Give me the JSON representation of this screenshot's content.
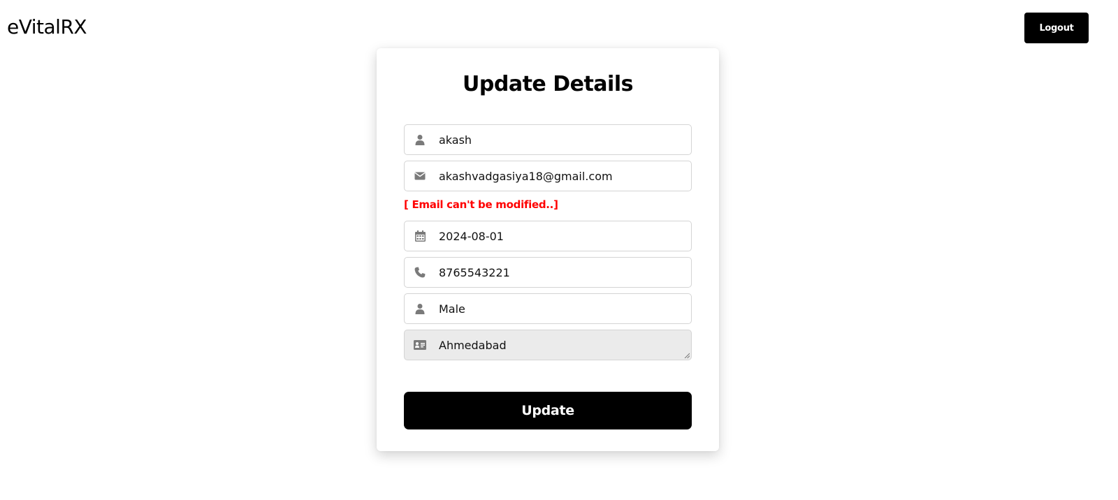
{
  "header": {
    "brand": "eVitalRX",
    "logout_label": "Logout"
  },
  "form": {
    "title": "Update Details",
    "name": {
      "value": "akash",
      "icon": "user-icon"
    },
    "email": {
      "value": "akashvadgasiya18@gmail.com",
      "icon": "envelope-icon"
    },
    "email_note": "[ Email can't be modified..]",
    "dob": {
      "value": "2024-08-01",
      "icon": "calendar-icon"
    },
    "phone": {
      "value": "8765543221",
      "icon": "phone-icon"
    },
    "gender": {
      "value": "Male",
      "icon": "user-icon"
    },
    "address": {
      "value": "Ahmedabad",
      "icon": "id-card-icon"
    },
    "submit_label": "Update"
  },
  "colors": {
    "accent": "#000000",
    "error": "#ff0000",
    "icon": "#7a7a7a",
    "textarea_bg": "#ebebeb"
  }
}
